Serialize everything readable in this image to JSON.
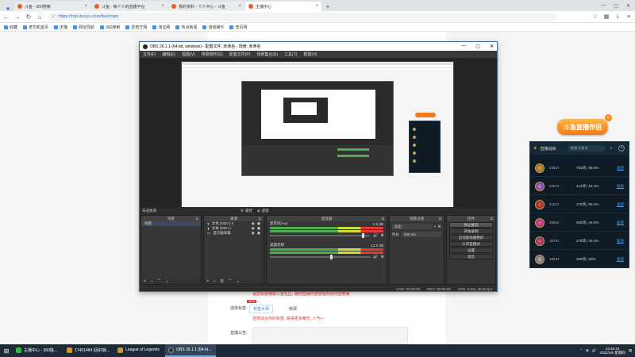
{
  "browser": {
    "tabs": [
      {
        "label": "斗鱼 - 360搜索",
        "active": false
      },
      {
        "label": "斗鱼 - 每个人的直播平台",
        "active": false
      },
      {
        "label": "我的资料 - 个人中心 - 斗鱼",
        "active": false
      },
      {
        "label": "主播中心",
        "active": true
      }
    ],
    "new_tab": "+",
    "url": "https://mp.douyu.com/live/main",
    "bookmarks": [
      "收藏",
      "老司机首页",
      "天猫",
      "网址导航",
      "360搜索",
      "爱奇艺网",
      "淘宝网",
      "热点新闻",
      "游戏娱乐",
      "查页网"
    ]
  },
  "page": {
    "notice": "请您需要遵循斗鱼社区, 做好直播内容管理规范内容质量",
    "label_select": "选择标签:",
    "tag_new": "NEW",
    "tag_btn": "标签大师",
    "tag_edit": "修改",
    "tag_hint": "选择适合你的标签, 获得更多曝光, 人气+~",
    "label_notice": "直播公告:"
  },
  "obs": {
    "title": "OBS 26.1.1 (64-bit, windows) - 配置文件: 未命名 - 场景: 未命名",
    "menu": [
      "文件(F)",
      "编辑(E)",
      "视图(V)",
      "停靠部件(D)",
      "配置文件(P)",
      "场景集合(S)",
      "工具(T)",
      "帮助(H)"
    ],
    "no_source": "未选择源",
    "props": "属性",
    "filters": "滤镜",
    "docks": {
      "scenes": {
        "title": "场景",
        "items": [
          "场景"
        ]
      },
      "sources": {
        "title": "来源",
        "items": [
          "文本 (GDI+) 2",
          "文本 (GDI+)",
          "显示器采集"
        ]
      },
      "mixer": {
        "title": "混音器",
        "channels": [
          {
            "name": "麦克风/Aux",
            "db": "-1.0 dB"
          },
          {
            "name": "桌面音频",
            "db": "-12.0 dB"
          }
        ]
      },
      "transitions": {
        "title": "场景过渡",
        "type": "淡出",
        "duration_label": "时长",
        "duration": "300 ms"
      },
      "controls": {
        "title": "控件",
        "buttons": [
          "停止推流",
          "开始录制",
          "启动虚拟摄像机",
          "工作室模式",
          "设置",
          "退出"
        ]
      }
    },
    "status": {
      "live": "LIVE: 00:00:00",
      "rec": "REC: 00:00:00",
      "cpu": "CPU: 0.5%, 30.00 fps"
    }
  },
  "douyu": {
    "banner": "斗鱼直播伴侣",
    "header": "直播战绩",
    "search_placeholder": "搜索斗鱼号",
    "rows": [
      {
        "id": "24847",
        "stat": "752场 | 58.6%",
        "link": "复盘"
      },
      {
        "id": "23574",
        "stat": "414场 | 52.4%",
        "link": "复盘"
      },
      {
        "id": "21547",
        "stat": "176场 | 58.2%",
        "link": "复盘"
      },
      {
        "id": "20842",
        "stat": "506场 | 46.6%",
        "link": "复盘"
      },
      {
        "id": "19701",
        "stat": "278场 | 46.4%",
        "link": "复盘"
      },
      {
        "id": "18634",
        "stat": "206场 | 50%",
        "link": "复盘"
      }
    ]
  },
  "taskbar": {
    "apps": [
      {
        "label": "主播中心 - 360极...",
        "color": "#3db54a",
        "active": false
      },
      {
        "label": "17401484 (回村就...",
        "color": "#c99a2e",
        "active": false
      },
      {
        "label": "League of Legends",
        "color": "#b89b4e",
        "active": false
      },
      {
        "label": "OBS 26.1.1 (64-bi...",
        "color": "#333333",
        "active": true
      }
    ],
    "time": "23:45:23",
    "date": "2022/1/6 星期四"
  }
}
